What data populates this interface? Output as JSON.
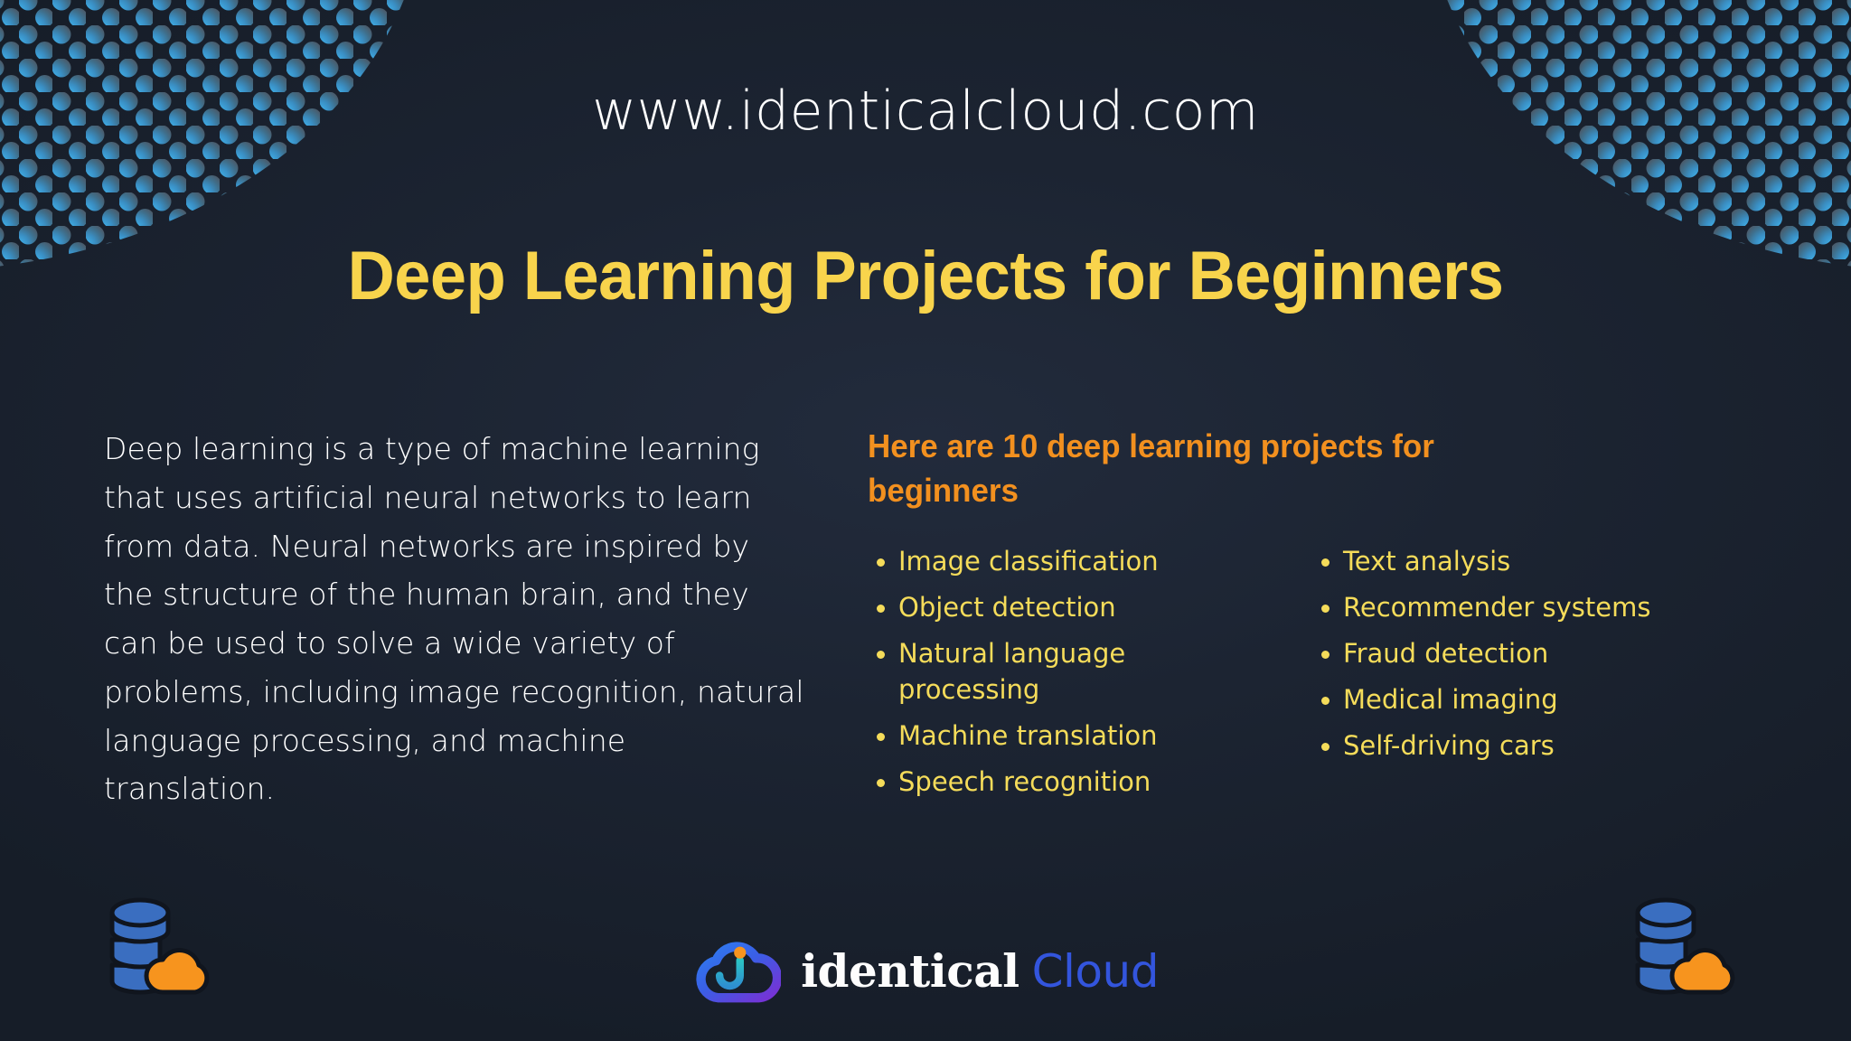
{
  "header": {
    "site_url": "www.identicalcloud.com",
    "title": "Deep Learning Projects for Beginners"
  },
  "intro": {
    "paragraph": "Deep learning is a type of machine learning that uses artificial neural networks to learn from data. Neural networks are inspired by the structure of the human brain, and they can be used to solve a wide variety of problems, including image recognition, natural language processing, and machine translation."
  },
  "projects": {
    "heading": "Here are 10 deep learning projects for beginners",
    "column_one": [
      "Image classification",
      "Object detection",
      "Natural language processing",
      "Machine translation",
      "Speech recognition"
    ],
    "column_two": [
      "Text analysis",
      "Recommender systems",
      "Fraud detection",
      "Medical imaging",
      "Self-driving cars"
    ]
  },
  "footer": {
    "brand_primary": "identical",
    "brand_secondary": "Cloud",
    "icon_left_name": "database-cloud-icon",
    "icon_right_name": "database-cloud-icon"
  },
  "colors": {
    "background": "#1b2230",
    "title_yellow": "#f8d44c",
    "list_yellow": "#f5dc5a",
    "heading_orange": "#f2901f",
    "body_white": "#ffffff",
    "dot_blue": "#3b9fe0",
    "brand_blue": "#3355dd",
    "brand_purple": "#7b2fd4",
    "icon_blue": "#3a6ec0",
    "icon_orange": "#f7941e",
    "accent_teal": "#2bc4c4"
  }
}
